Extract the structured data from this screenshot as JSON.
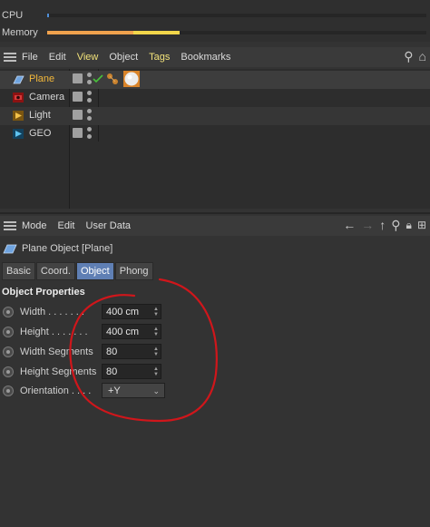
{
  "stats": {
    "cpu_label": "CPU",
    "memory_label": "Memory",
    "cpu_fraction": 0.005,
    "memory_fraction": 0.35,
    "memory_colors": [
      "#f0a24d",
      "#f2d64a"
    ]
  },
  "object_manager": {
    "menu": [
      {
        "label": "File",
        "active": false
      },
      {
        "label": "Edit",
        "active": false
      },
      {
        "label": "View",
        "active": true
      },
      {
        "label": "Object",
        "active": false
      },
      {
        "label": "Tags",
        "active": true
      },
      {
        "label": "Bookmarks",
        "active": false
      }
    ],
    "objects": [
      {
        "name": "Plane",
        "icon": "plane-icon",
        "selected": true,
        "color": "#f2b73a"
      },
      {
        "name": "Camera",
        "icon": "camera-icon",
        "selected": false,
        "color": "#d8d8d8"
      },
      {
        "name": "Light",
        "icon": "light-icon",
        "selected": false,
        "color": "#d8d8d8"
      },
      {
        "name": "GEO",
        "icon": "geo-icon",
        "selected": false,
        "color": "#d8d8d8"
      }
    ]
  },
  "attribute_manager": {
    "menu": [
      "Mode",
      "Edit",
      "User Data"
    ],
    "title": "Plane Object [Plane]",
    "tabs": [
      {
        "label": "Basic",
        "active": false
      },
      {
        "label": "Coord.",
        "active": false
      },
      {
        "label": "Object",
        "active": true
      },
      {
        "label": "Phong",
        "active": false
      }
    ],
    "group_title": "Object Properties",
    "properties": [
      {
        "label": "Width . . . . . . .",
        "value": "400 cm",
        "kind": "number"
      },
      {
        "label": "Height . . . . . . .",
        "value": "400 cm",
        "kind": "number"
      },
      {
        "label": "Width Segments",
        "value": "80",
        "kind": "number"
      },
      {
        "label": "Height Segments",
        "value": "80",
        "kind": "number"
      },
      {
        "label": "Orientation . . . .",
        "value": "+Y",
        "kind": "select"
      }
    ]
  },
  "annotation": {
    "color": "#d0161b"
  }
}
